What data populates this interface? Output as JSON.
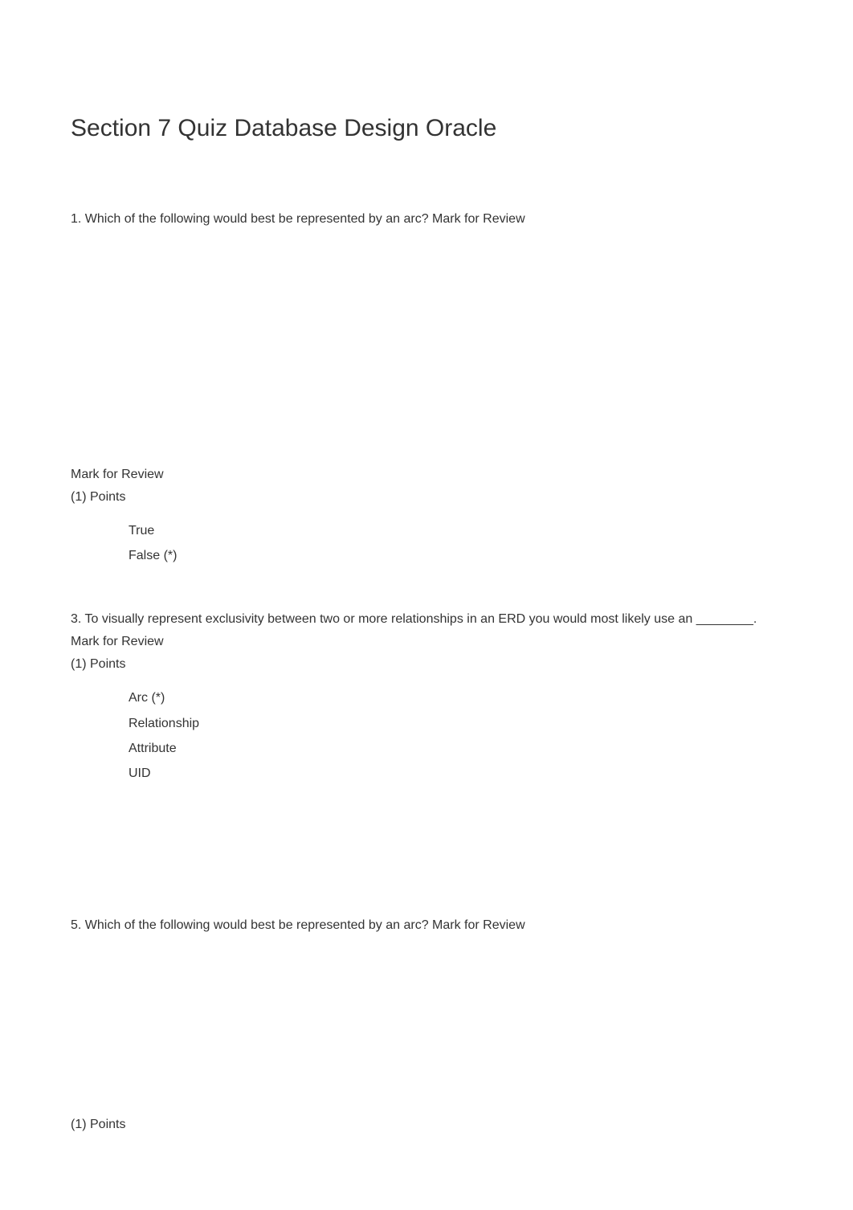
{
  "title": "Section 7 Quiz Database Design Oracle",
  "q1": {
    "text": "1. Which of the following would best be represented by an arc? Mark for Review"
  },
  "q2": {
    "prefix": "Mark for Review",
    "points": "(1) Points",
    "options": [
      "True",
      "False (*)"
    ]
  },
  "q3": {
    "text": "3. To visually represent exclusivity between two or more relationships in an ERD you would most likely use an ________. Mark for Review",
    "points": "(1) Points",
    "options": [
      "Arc (*)",
      "Relationship",
      "Attribute",
      "UID"
    ]
  },
  "q5": {
    "text": "5. Which of the following would best be represented by an arc? Mark for Review"
  },
  "footer": {
    "points": "(1) Points"
  }
}
